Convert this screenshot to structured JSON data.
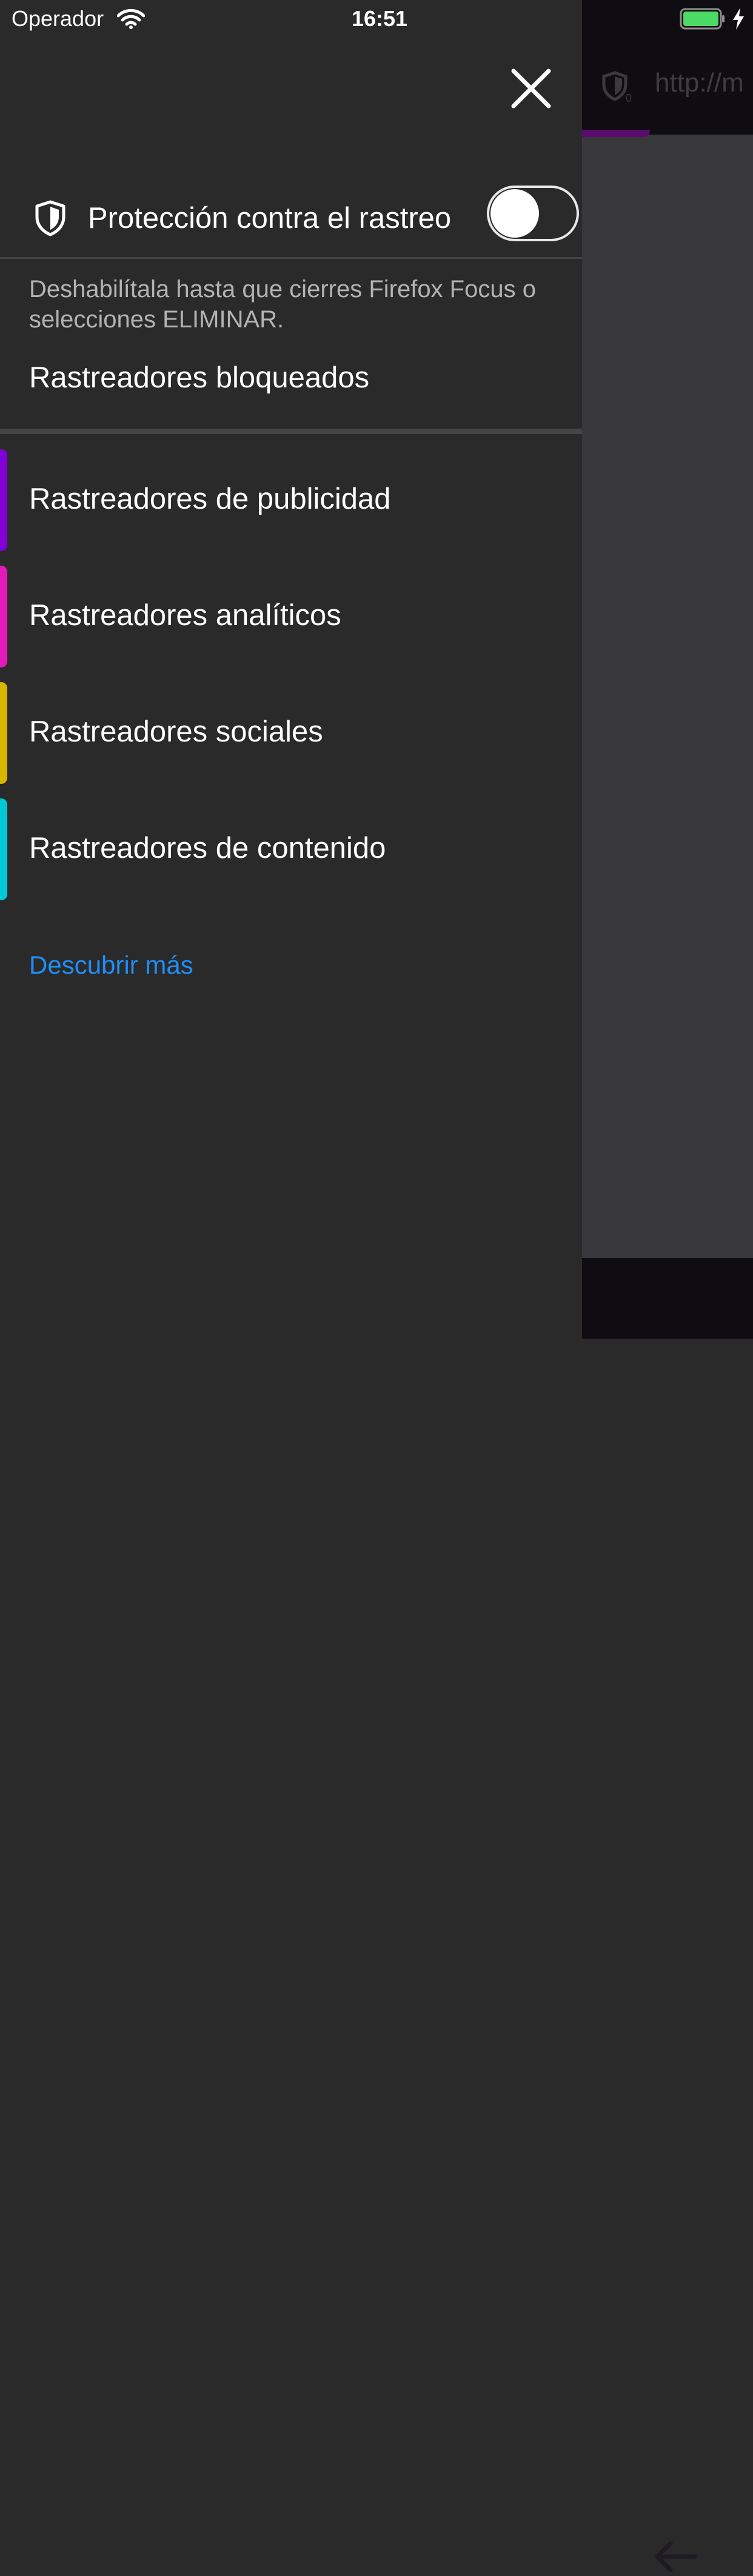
{
  "status_bar": {
    "carrier": "Operador",
    "time": "16:51",
    "battery_color": "#4cd964"
  },
  "background_browser": {
    "url": "http://m"
  },
  "panel": {
    "tracking_protection": {
      "label": "Protección contra el rastreo",
      "enabled": false,
      "description": "Deshabilítala hasta que cierres Firefox Focus o selecciones ELIMINAR."
    },
    "blocked_title": "Rastreadores bloqueados",
    "trackers": [
      {
        "label": "Rastreadores de publicidad",
        "color": "#8000d7"
      },
      {
        "label": "Rastreadores analíticos",
        "color": "#e31ab8"
      },
      {
        "label": "Rastreadores sociales",
        "color": "#d7b600"
      },
      {
        "label": "Rastreadores de contenido",
        "color": "#00c8d7"
      }
    ],
    "learn_more": "Descubrir más",
    "learn_more_color": "#1f8ff7"
  }
}
